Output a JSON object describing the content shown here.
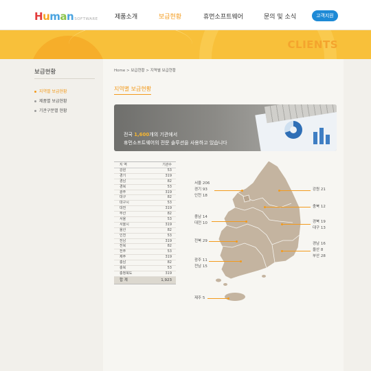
{
  "header": {
    "logo": {
      "h": "H",
      "u": "u",
      "m": "m",
      "a": "a",
      "n": "n",
      "suffix": "SOFTWARE"
    },
    "nav": [
      "제품소개",
      "보급현황",
      "휴먼소프트웨어",
      "문의 및 소식"
    ],
    "active_nav": "보급현황",
    "support_button": "고객지원"
  },
  "banner": {
    "title": "CLIENTS"
  },
  "sidebar": {
    "title": "보급현황",
    "items": [
      {
        "label": "지역별 보급현황",
        "active": true
      },
      {
        "label": "제품별 보급현황",
        "active": false
      },
      {
        "label": "기관구분별 현황",
        "active": false
      }
    ]
  },
  "breadcrumb": {
    "home": "Home",
    "sep1": ">",
    "section": "보급현황",
    "sep2": ">",
    "page": "지역별 보급현황"
  },
  "section_title": "지역별 보급현황",
  "hero": {
    "line1_pre": "전국 ",
    "line1_highlight": "1,600",
    "line1_post": "개의 기관에서",
    "line2": "휴먼소프트웨어의 전문 솔루션을 사용하고 있습니다"
  },
  "table": {
    "headers": [
      "지 역",
      "기관수"
    ],
    "rows": [
      [
        "강원",
        "53"
      ],
      [
        "경기",
        "319"
      ],
      [
        "경남",
        "82"
      ],
      [
        "경북",
        "53"
      ],
      [
        "광주",
        "319"
      ],
      [
        "대구",
        "82"
      ],
      [
        "대구시",
        "53"
      ],
      [
        "대전",
        "319"
      ],
      [
        "부산",
        "82"
      ],
      [
        "서울",
        "53"
      ],
      [
        "서울시",
        "319"
      ],
      [
        "울산",
        "82"
      ],
      [
        "인천",
        "53"
      ],
      [
        "전남",
        "319"
      ],
      [
        "전북",
        "82"
      ],
      [
        "전주",
        "53"
      ],
      [
        "제주",
        "319"
      ],
      [
        "충남",
        "82"
      ],
      [
        "충북",
        "53"
      ],
      [
        "충청북도",
        "319"
      ]
    ],
    "total_label": "합 계",
    "total_value": "1,923"
  },
  "map_labels": {
    "seoul": "서울 206",
    "gyeonggi": "경기 93",
    "incheon": "인천 18",
    "gangwon": "강원 21",
    "chungbuk": "충북 12",
    "chungnam": "충남 14",
    "daejeon": "대전 10",
    "gyeongbuk": "경북 19",
    "daegu": "대구 13",
    "jeonbuk": "전북 29",
    "gwangju": "광주 11",
    "jeonnam": "전남 15",
    "gyeongnam": "경남 16",
    "ulsan": "울산 8",
    "busan": "부산 28",
    "jeju": "제주 5"
  },
  "colors": {
    "accent": "#f39a1b",
    "map_fill": "#c4b4a0",
    "support_blue": "#1e8ad6"
  }
}
